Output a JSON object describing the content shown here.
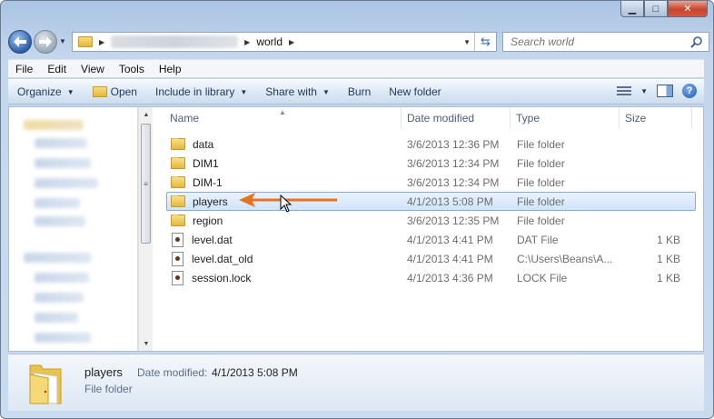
{
  "window": {
    "caption_min": "▁",
    "caption_max": "□",
    "caption_close": "✕"
  },
  "address": {
    "current_folder": "world",
    "search_placeholder": "Search world"
  },
  "menu": {
    "items": [
      "File",
      "Edit",
      "View",
      "Tools",
      "Help"
    ]
  },
  "toolbar": {
    "organize": "Organize",
    "open": "Open",
    "include_in_library": "Include in library",
    "share_with": "Share with",
    "burn": "Burn",
    "new_folder": "New folder"
  },
  "columns": {
    "name": "Name",
    "date_modified": "Date modified",
    "type": "Type",
    "size": "Size"
  },
  "files": [
    {
      "name": "data",
      "date": "3/6/2013 12:36 PM",
      "type": "File folder",
      "size": "",
      "kind": "folder"
    },
    {
      "name": "DIM1",
      "date": "3/6/2013 12:34 PM",
      "type": "File folder",
      "size": "",
      "kind": "folder"
    },
    {
      "name": "DIM-1",
      "date": "3/6/2013 12:34 PM",
      "type": "File folder",
      "size": "",
      "kind": "folder"
    },
    {
      "name": "players",
      "date": "4/1/2013 5:08 PM",
      "type": "File folder",
      "size": "",
      "kind": "folder",
      "selected": true
    },
    {
      "name": "region",
      "date": "3/6/2013 12:35 PM",
      "type": "File folder",
      "size": "",
      "kind": "folder"
    },
    {
      "name": "level.dat",
      "date": "4/1/2013 4:41 PM",
      "type": "DAT File",
      "size": "1 KB",
      "kind": "file"
    },
    {
      "name": "level.dat_old",
      "date": "4/1/2013 4:41 PM",
      "type": "C:\\Users\\Beans\\A...",
      "size": "1 KB",
      "kind": "file"
    },
    {
      "name": "session.lock",
      "date": "4/1/2013 4:36 PM",
      "type": "LOCK File",
      "size": "1 KB",
      "kind": "file"
    }
  ],
  "details": {
    "name": "players",
    "date_label": "Date modified:",
    "date_value": "4/1/2013 5:08 PM",
    "type": "File folder"
  },
  "colors": {
    "selection_border": "#84acdd",
    "annotation_arrow": "#e8731e"
  }
}
